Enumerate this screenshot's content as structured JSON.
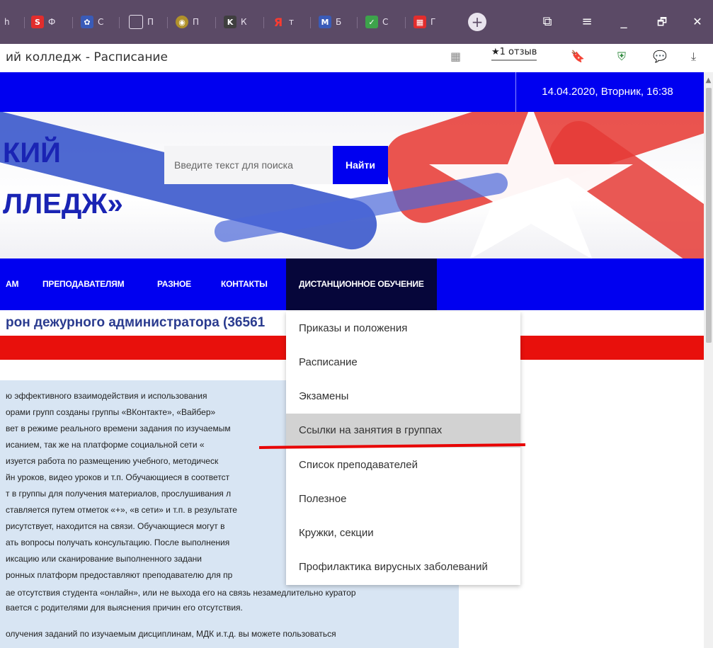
{
  "browser": {
    "tabs": [
      {
        "label": "h",
        "icon": "site-icon",
        "color": "#6d5c79"
      },
      {
        "label": "Ф",
        "icon": "s-logo-icon",
        "color": "#e22d2d",
        "glyph": "S"
      },
      {
        "label": "C",
        "icon": "emblem-icon",
        "color": "#3a5bb8",
        "glyph": "✿"
      },
      {
        "label": "П",
        "icon": "page-icon",
        "color": "#6d5c79",
        "glyph": "▯"
      },
      {
        "label": "П",
        "icon": "emblem-icon",
        "color": "#b0912a",
        "glyph": "◉"
      },
      {
        "label": "К",
        "icon": "k-logo-icon",
        "color": "#3f3f3f",
        "glyph": "K"
      },
      {
        "label": "т",
        "icon": "yandex-icon",
        "color": "#e22d2d",
        "glyph": "Я"
      },
      {
        "label": "Б",
        "icon": "gmail-icon",
        "color": "#3a5bb8",
        "glyph": "M"
      },
      {
        "label": "С",
        "icon": "check-shield-icon",
        "color": "#3da34b",
        "glyph": "✓"
      },
      {
        "label": "Г",
        "icon": "qr-icon",
        "color": "#e22d2d",
        "glyph": "▦"
      }
    ],
    "new_tab_label": "+",
    "controls": {
      "tabs": "⧉",
      "menu": "≡",
      "minimize": "_",
      "restore": "🗗",
      "close": "✕"
    },
    "page_title": "ий колледж - Расписание",
    "reviews_label": "★1 отзыв",
    "addr_icons": {
      "reader": "▦",
      "bookmark": "🔖",
      "shield": "⛨",
      "chat": "💬",
      "download": "⤓"
    }
  },
  "site": {
    "datetime": "14.04.2020, Вторник, 16:38",
    "brand_line1": "КИЙ",
    "brand_line2": "ЛЛЕДЖ»",
    "search": {
      "placeholder": "Введите текст для поиска",
      "button": "Найти"
    },
    "nav": [
      "АМ",
      "ПРЕПОДАВАТЕЛЯМ",
      "РАЗНОЕ",
      "КОНТАКТЫ",
      "ДИСТАНЦИОННОЕ ОБУЧЕНИЕ"
    ],
    "phone_line": "рон дежурного администратора (36561",
    "paragraphs": [
      "ю эффективного взаимодействия и использования",
      "орами групп созданы группы «ВКонтакте», «Вайбер»",
      "вет в режиме реального времени задания по изучаемым",
      "исанием, так же на платформе социальной сети «",
      "изуется работа по размещению учебного, методическ",
      "йн уроков, видео уроков и т.п. Обучающиеся в соответст",
      "т в группы для получения материалов, прослушивания л",
      "ставляется путем отметок «+», «в сети» и т.п. в результате",
      "рисутствует, находится на связи. Обучающиеся могут в",
      "ать вопросы получать консультацию. После выполнения",
      "иксацию или сканирование выполненного задани",
      "ронных платформ предоставляют преподавателю для пр",
      "ае отсутствия студента «онлайн», или не выхода его на связь незамедлительно куратор",
      "вается с родителями для выяснения причин его отсутствия.",
      "олучения заданий по изучаемым дисциплинам, МДК и.т.д. вы можете пользоваться"
    ],
    "dropdown": [
      "Приказы и положения",
      "Расписание",
      "Экзамены",
      "Ссылки на занятия в группах",
      "Список преподавателей",
      "Полезное",
      "Кружки, секции",
      "Профилактика вирусных заболеваний"
    ]
  }
}
